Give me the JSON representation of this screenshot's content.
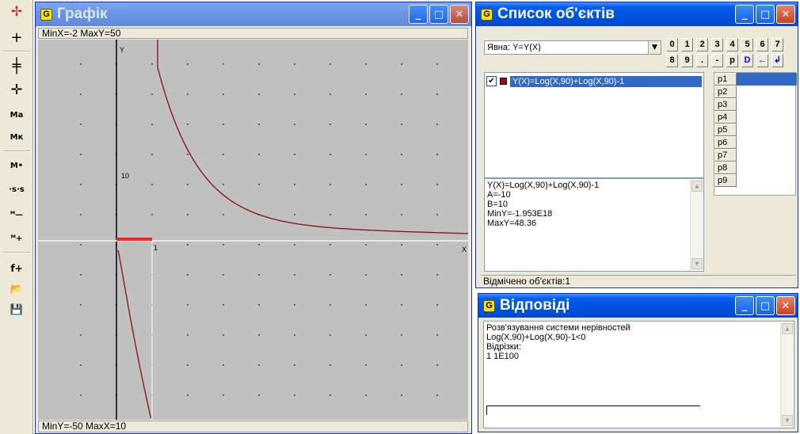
{
  "toolbar": {
    "buttons": [
      {
        "name": "axes-icon",
        "glyph": "✢"
      },
      {
        "name": "crosshair-icon",
        "glyph": "+"
      },
      {
        "name": "point-pin-icon",
        "glyph": "╪"
      },
      {
        "name": "point-cross-icon",
        "glyph": "✛"
      },
      {
        "name": "label-a",
        "glyph": "Ma"
      },
      {
        "name": "label-k",
        "glyph": "Mк"
      },
      {
        "name": "label-dot",
        "glyph": "M•"
      },
      {
        "name": "scale-s",
        "glyph": "·s·s"
      },
      {
        "name": "zoom-out-icon",
        "glyph": "ᴹ—"
      },
      {
        "name": "zoom-in-icon",
        "glyph": "ᴹ+"
      },
      {
        "name": "add-function-icon",
        "glyph": "f+"
      },
      {
        "name": "open-folder-icon",
        "glyph": "📂"
      },
      {
        "name": "save-disk-icon",
        "glyph": "💾"
      }
    ]
  },
  "graph_window": {
    "title": "Графік",
    "info_top": "MinX=-2  MaxY=50",
    "info_bottom": "MinY=-50  MaxX=10",
    "axis_x_label": "X",
    "axis_y_label": "Y",
    "tick_x_label": "1",
    "tick_y_label": "10",
    "colors": {
      "background": "#c0c0c0",
      "curve": "#8b1a1a",
      "highlight": "#ff2020",
      "axis": "#000000",
      "grid_dot": "#606060"
    }
  },
  "objects_window": {
    "title": "Список об'єктів",
    "type_select": "Явна: Y=Y(X)",
    "keypad_row1": [
      "0",
      "1",
      "2",
      "3",
      "4",
      "5",
      "6",
      "7"
    ],
    "keypad_row2": [
      "8",
      "9",
      ".",
      "-",
      "p",
      "D",
      "←",
      "↲"
    ],
    "object_item": "Y(X)=Log(X,90)+Log(X,90)-1",
    "description": [
      "Y(X)=Log(X,90)+Log(X,90)-1",
      "A=-10",
      "B=10",
      "MinY=-1.953E18",
      "MaxY=48.36"
    ],
    "params": [
      "p1",
      "p2",
      "p3",
      "p4",
      "p5",
      "p6",
      "p7",
      "p8",
      "p9"
    ],
    "status": "Відмічено об'єктів:1"
  },
  "answers_window": {
    "title": "Відповіді",
    "lines": [
      "Розв'язування системи нерівностей",
      "Log(X,90)+Log(X,90)-1<0",
      "Відрізки:",
      "1   1E100"
    ]
  }
}
